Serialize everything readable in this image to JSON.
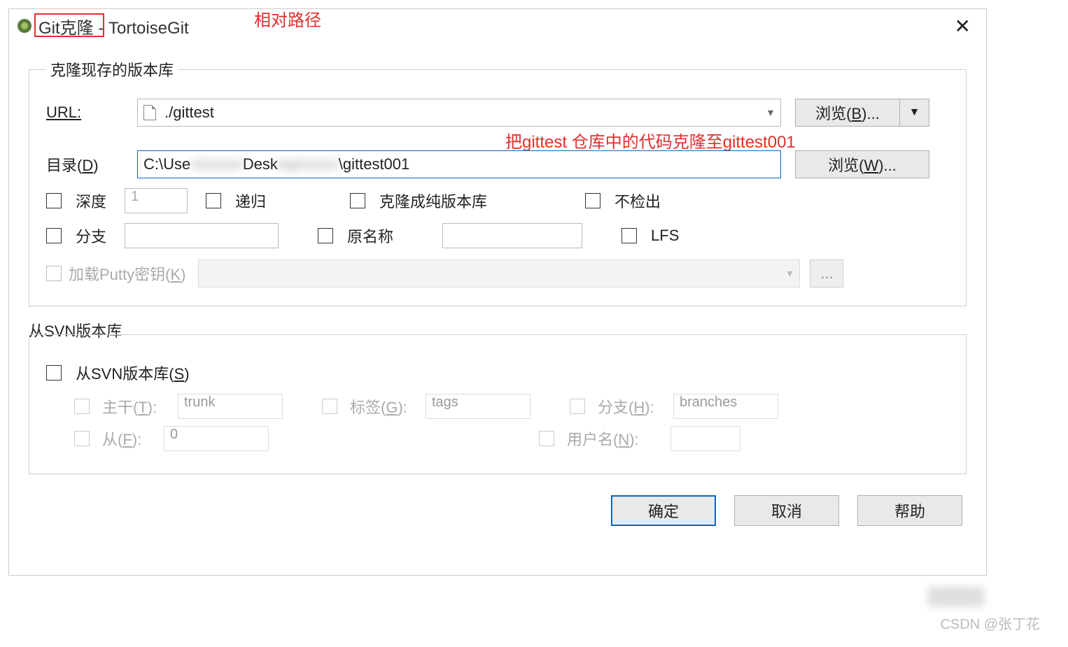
{
  "title": {
    "app": "Git克隆",
    "suffix": " - TortoiseGit"
  },
  "annotations": {
    "relative_path": "相对路径",
    "clone_note": "把gittest 仓库中的代码克隆至gittest001"
  },
  "group1": {
    "legend": "克隆现存的版本库",
    "url_label": "URL:",
    "url_value": "./gittest",
    "browse_b": "浏览(B)...",
    "dir_label": "目录(D)",
    "dir_prefix": "C:\\Use",
    "dir_mid1": "rs\\xxxx\\",
    "dir_mid2": "Desk",
    "dir_mid3": "top\\xxxx\\",
    "dir_suffix": "\\gittest001",
    "browse_w": "浏览(W)...",
    "depth": "深度",
    "depth_val": "1",
    "recursive": "递归",
    "bare": "克隆成纯版本库",
    "nocheckout": "不检出",
    "branch": "分支",
    "origname": "原名称",
    "lfs": "LFS",
    "putty": "加载Putty密钥(K)"
  },
  "svn": {
    "legend": "从SVN版本库",
    "from_svn": "从SVN版本库(S)",
    "trunk_lbl": "主干(T):",
    "trunk_val": "trunk",
    "tags_lbl": "标签(G):",
    "tags_val": "tags",
    "branch_lbl": "分支(H):",
    "branch_val": "branches",
    "from_lbl": "从(F):",
    "from_val": "0",
    "user_lbl": "用户名(N):"
  },
  "footer": {
    "ok": "确定",
    "cancel": "取消",
    "help": "帮助"
  },
  "watermark": "CSDN @张丁花"
}
